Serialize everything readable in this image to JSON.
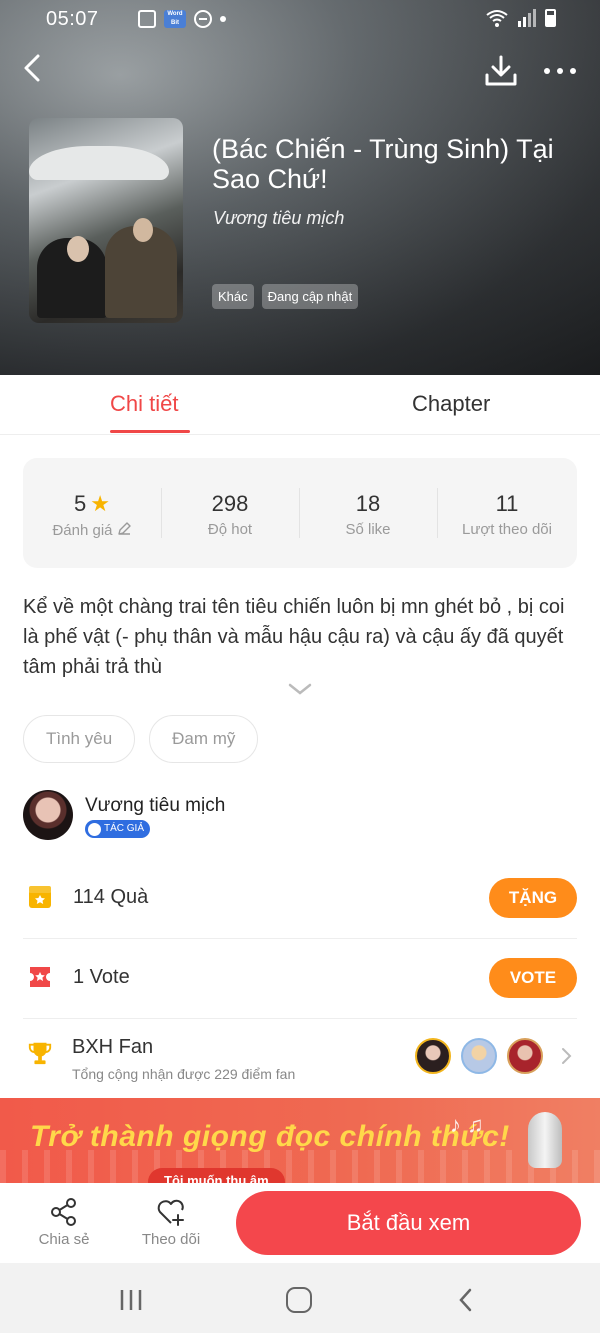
{
  "status_bar": {
    "time": "05:07",
    "badge_text": "Word Bit"
  },
  "book": {
    "title": "(Bác Chiến - Trùng Sinh) Tại Sao Chứ!",
    "author": "Vương tiêu mịch",
    "chips": [
      "Khác",
      "Đang cập nhật"
    ]
  },
  "tabs": {
    "detail": "Chi tiết",
    "chapter": "Chapter"
  },
  "stats": {
    "rating_value": "5",
    "rating_label": "Đánh giá",
    "hot_value": "298",
    "hot_label": "Độ hot",
    "like_value": "18",
    "like_label": "Số like",
    "follow_value": "11",
    "follow_label": "Lượt theo dõi"
  },
  "description": "Kể về một chàng trai tên tiêu chiến luôn bị mn ghét bỏ , bị coi là phế vật (- phụ thân và mẫu hậu cậu ra) và cậu ấy đã quyết tâm phải trả thù",
  "tags": [
    "Tình yêu",
    "Đam mỹ"
  ],
  "author_section": {
    "name": "Vương tiêu mịch",
    "badge": "TÁC GIẢ"
  },
  "gift": {
    "text": "114 Quà",
    "button": "TẶNG"
  },
  "vote": {
    "text": "1 Vote",
    "button": "VOTE"
  },
  "fan_ranking": {
    "title": "BXH Fan",
    "subtitle": "Tổng cộng nhận được 229 điểm fan"
  },
  "banner": {
    "text": "Trở thành giọng đọc chính thức!",
    "button": "Tôi muốn thu âm"
  },
  "bottom_bar": {
    "share": "Chia sẻ",
    "follow": "Theo dõi",
    "start": "Bắt đầu xem"
  },
  "colors": {
    "accent": "#f04747",
    "orange": "#ff8c1a",
    "start_button": "#f4474c"
  }
}
